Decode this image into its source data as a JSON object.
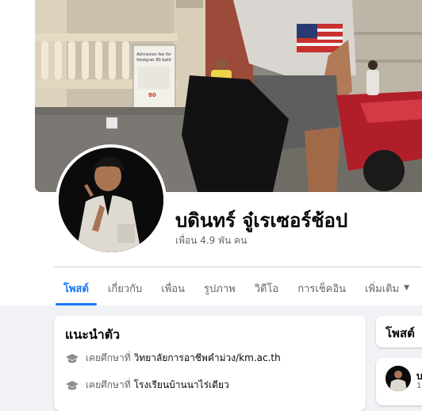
{
  "profile": {
    "name": "บดินทร์ จู๋เรเซอร์ช้อป",
    "friends": "เพื่อน 4.9 พัน คน"
  },
  "cover_sign": {
    "line1": "Admission fee for",
    "line2": "foreigner 80 baht",
    "price": "80"
  },
  "tabs": [
    {
      "label": "โพสต์",
      "active": true
    },
    {
      "label": "เกี่ยวกับ"
    },
    {
      "label": "เพื่อน"
    },
    {
      "label": "รูปภาพ"
    },
    {
      "label": "วิดีโอ"
    },
    {
      "label": "การเช็คอิน"
    },
    {
      "label": "เพิ่มเติม"
    }
  ],
  "intro": {
    "title": "แนะนำตัว",
    "items": [
      {
        "prefix": "เคยศึกษาที่",
        "value": "วิทยาลัยการอาชีพคำม่วง/km.ac.th",
        "icon": "graduation-cap-icon"
      },
      {
        "prefix": "เคยศึกษาที่",
        "value": "โรงเรียนบ้านนาไร่เดียว",
        "icon": "graduation-cap-icon"
      }
    ]
  },
  "posts": {
    "title": "โพสต์",
    "first_author_initial": "บ",
    "first_meta": "1"
  },
  "colors": {
    "accent": "#1877f2",
    "page_bg": "#f0f2f5",
    "secondary_text": "#65676b"
  }
}
